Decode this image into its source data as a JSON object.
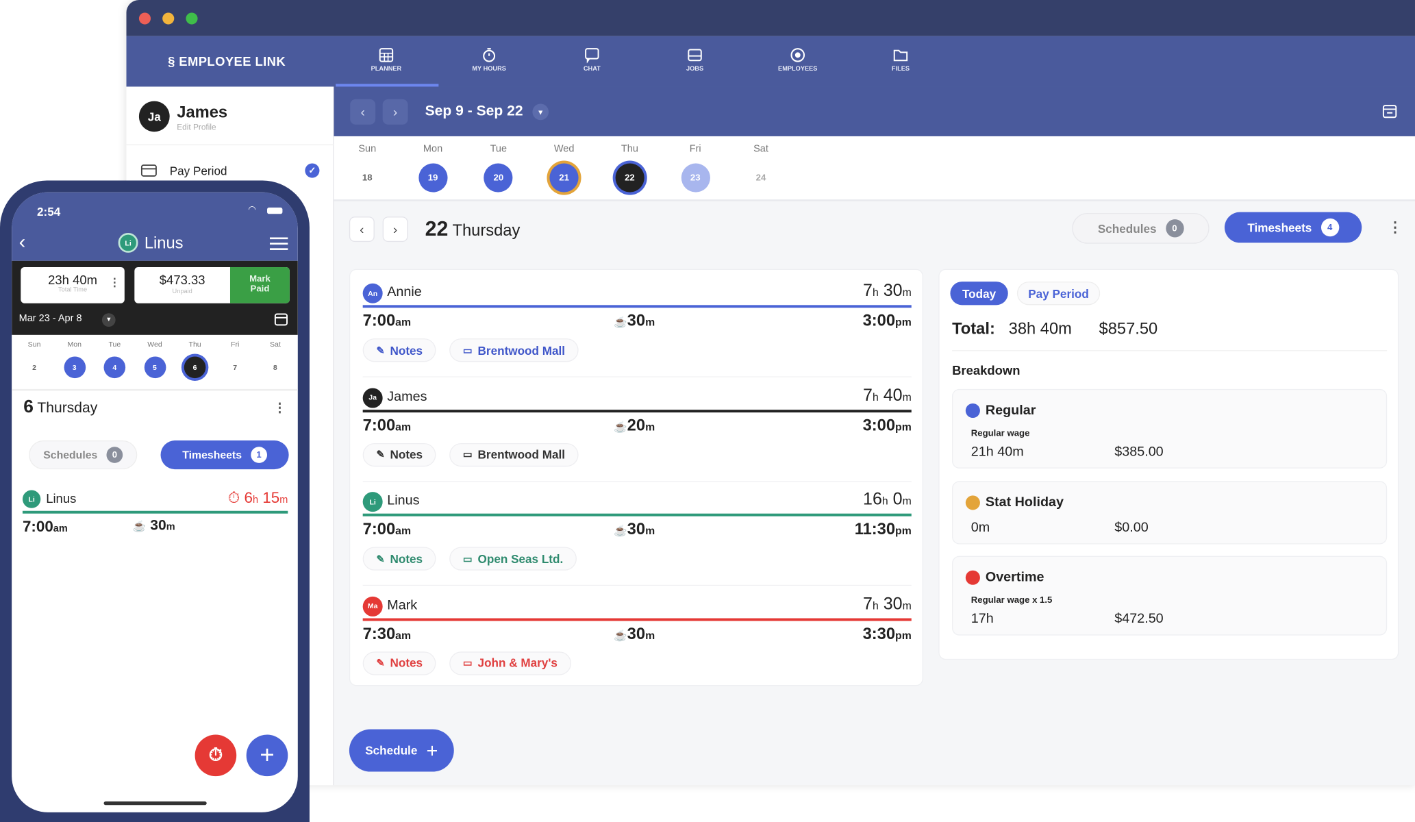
{
  "colors": {
    "accent": "#4a63d6",
    "nav": "#4a5a9c",
    "titlebar": "#35406a",
    "teal": "#2e9a7a",
    "red": "#e53935",
    "amber": "#e3a43a",
    "green": "#3a9f45"
  },
  "app": {
    "logo": "EMPLOYEE LINK",
    "nav": [
      {
        "label": "PLANNER",
        "icon": "planner-icon"
      },
      {
        "label": "MY HOURS",
        "icon": "stopwatch-icon"
      },
      {
        "label": "CHAT",
        "icon": "chat-icon"
      },
      {
        "label": "JOBS",
        "icon": "jobs-icon"
      },
      {
        "label": "EMPLOYEES",
        "icon": "employees-icon"
      },
      {
        "label": "FILES",
        "icon": "folder-icon"
      }
    ],
    "active_nav": "PLANNER"
  },
  "sidebar": {
    "user_initials": "Ja",
    "user_name": "James",
    "edit_profile": "Edit Profile",
    "pay_period": "Pay Period"
  },
  "datebar": {
    "range": "Sep 9 - Sep 22"
  },
  "week": {
    "days": [
      "Sun",
      "Mon",
      "Tue",
      "Wed",
      "Thu",
      "Fri",
      "Sat"
    ],
    "dates": [
      "18",
      "19",
      "20",
      "21",
      "22",
      "23",
      "24"
    ]
  },
  "day": {
    "number": "22",
    "name": "Thursday",
    "schedules_label": "Schedules",
    "schedules_count": "0",
    "timesheets_label": "Timesheets",
    "timesheets_count": "4"
  },
  "entries": [
    {
      "initials": "An",
      "name": "Annie",
      "hours": "7",
      "mins": "30",
      "start": "7:00",
      "start_ap": "am",
      "break": "30",
      "end": "3:00",
      "end_ap": "pm",
      "notes": "Notes",
      "location": "Brentwood Mall",
      "color": "#4a63d6",
      "text": "#3f56c9"
    },
    {
      "initials": "Ja",
      "name": "James",
      "hours": "7",
      "mins": "40",
      "start": "7:00",
      "start_ap": "am",
      "break": "20",
      "end": "3:00",
      "end_ap": "pm",
      "notes": "Notes",
      "location": "Brentwood Mall",
      "color": "#222222",
      "text": "#333333"
    },
    {
      "initials": "Li",
      "name": "Linus",
      "hours": "16",
      "mins": "0",
      "start": "7:00",
      "start_ap": "am",
      "break": "30",
      "end": "11:30",
      "end_ap": "pm",
      "notes": "Notes",
      "location": "Open Seas Ltd.",
      "color": "#2e9a7a",
      "text": "#2e8a6e"
    },
    {
      "initials": "Ma",
      "name": "Mark",
      "hours": "7",
      "mins": "30",
      "start": "7:30",
      "start_ap": "am",
      "break": "30",
      "end": "3:30",
      "end_ap": "pm",
      "notes": "Notes",
      "location": "John & Mary's",
      "color": "#e53935",
      "text": "#e04040"
    }
  ],
  "units": {
    "h": "h",
    "m": "m"
  },
  "summary": {
    "tab_today": "Today",
    "tab_pay_period": "Pay Period",
    "total_label": "Total:",
    "total_time": "38h 40m",
    "total_amount": "$857.50",
    "breakdown_label": "Breakdown",
    "items": [
      {
        "name": "Regular",
        "sub": "Regular wage",
        "time": "21h 40m",
        "amount": "$385.00",
        "color": "#4a63d6"
      },
      {
        "name": "Stat Holiday",
        "sub": "",
        "time": "0m",
        "amount": "$0.00",
        "color": "#e3a43a"
      },
      {
        "name": "Overtime",
        "sub": "Regular wage x 1.5",
        "time": "17h",
        "amount": "$472.50",
        "color": "#e53935"
      }
    ]
  },
  "schedule_button": "Schedule",
  "phone": {
    "time": "2:54",
    "initials": "Li",
    "name": "Linus",
    "total_time": "23h 40m",
    "total_time_label": "Total Time",
    "unpaid": "$473.33",
    "unpaid_label": "Unpaid",
    "mark_paid": "Mark Paid",
    "range": "Mar 23 - Apr 8",
    "days": [
      "Sun",
      "Mon",
      "Tue",
      "Wed",
      "Thu",
      "Fri",
      "Sat"
    ],
    "dates": [
      "2",
      "3",
      "4",
      "5",
      "6",
      "7",
      "8"
    ],
    "day_number": "6",
    "day_name": "Thursday",
    "schedules_label": "Schedules",
    "schedules_count": "0",
    "timesheets_label": "Timesheets",
    "timesheets_count": "1",
    "entry": {
      "initials": "Li",
      "name": "Linus",
      "hours": "6",
      "mins": "15",
      "start": "7:00",
      "start_ap": "am",
      "break": "30"
    }
  }
}
